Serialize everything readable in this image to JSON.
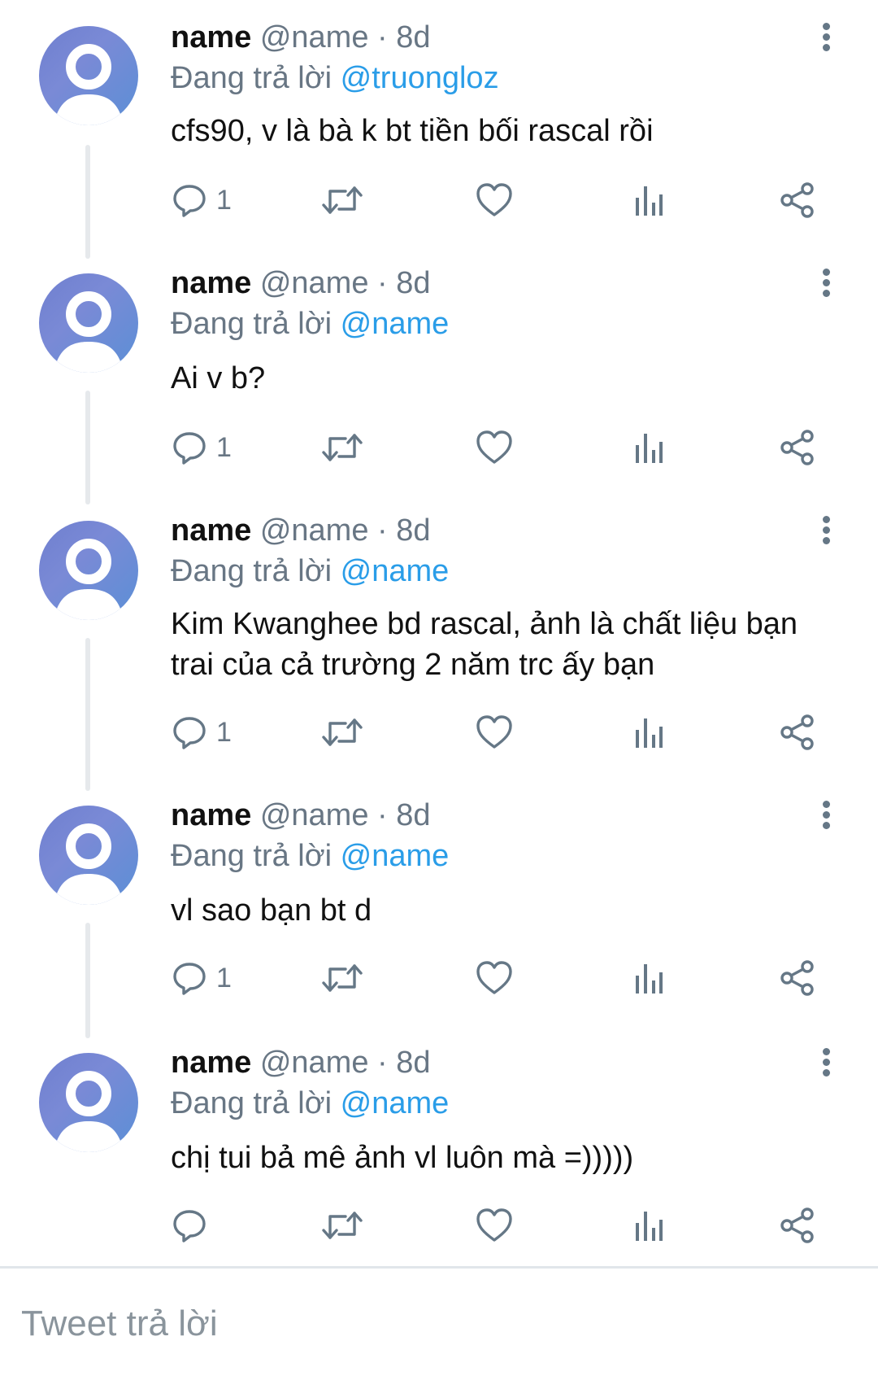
{
  "tweets": [
    {
      "name": "name",
      "handle": "@name · 8d",
      "reply_prefix": "Đang trả lời ",
      "reply_mention": "@truongloz",
      "content": "cfs90, v là bà k bt tiền bối rascal rồi",
      "reply_count": "1"
    },
    {
      "name": "name",
      "handle": "@name · 8d",
      "reply_prefix": "Đang trả lời ",
      "reply_mention": "@name",
      "content": "Ai v b?",
      "reply_count": "1"
    },
    {
      "name": "name",
      "handle": "@name · 8d",
      "reply_prefix": "Đang trả lời ",
      "reply_mention": "@name",
      "content": "Kim Kwanghee bd rascal, ảnh là chất liệu bạn trai của cả trường 2 năm trc ấy bạn",
      "reply_count": "1"
    },
    {
      "name": "name",
      "handle": "@name · 8d",
      "reply_prefix": "Đang trả lời ",
      "reply_mention": "@name",
      "content": "vl sao bạn bt d",
      "reply_count": "1"
    },
    {
      "name": "name",
      "handle": "@name · 8d",
      "reply_prefix": "Đang trả lời ",
      "reply_mention": "@name",
      "content": "chị tui bả mê ảnh vl luôn mà =)))))",
      "reply_count": ""
    }
  ],
  "composer": {
    "placeholder": "Tweet trả lời"
  },
  "icons": {
    "reply": "comment-bubble-icon",
    "retweet": "retweet-icon",
    "like": "heart-icon",
    "stats": "bar-chart-icon",
    "share": "share-icon",
    "more": "vertical-dots-icon",
    "avatar": "default-profile-icon"
  },
  "colors": {
    "mention": "#2a9de8",
    "secondary_text": "#687684",
    "avatar_gradient_start": "#6f7fcf",
    "avatar_gradient_end": "#5b8fd6"
  }
}
